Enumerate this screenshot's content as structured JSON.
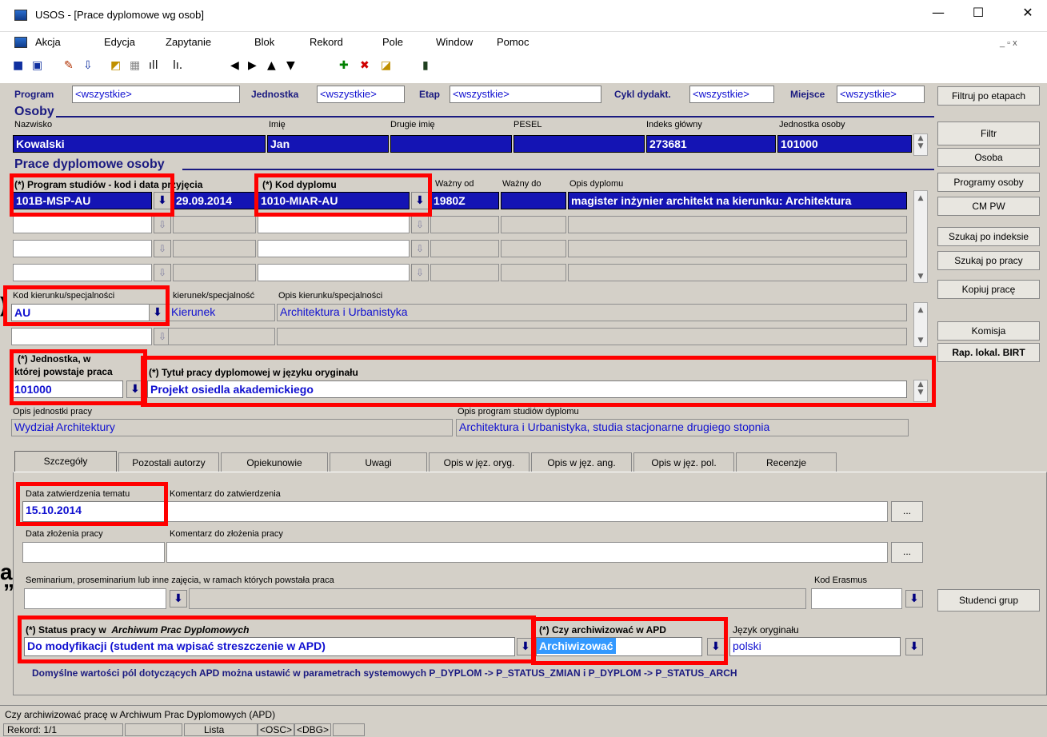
{
  "window": {
    "title": "USOS - [Prace dyplomowe wg osob]",
    "min": "—",
    "max": "☐",
    "close": "✕"
  },
  "menu": {
    "items": [
      "Akcja",
      "Edycja",
      "Zapytanie",
      "Blok",
      "Rekord",
      "Pole",
      "Window",
      "Pomoc"
    ],
    "mdi_controls": "_ ▫ x"
  },
  "toolbar": {
    "icons": [
      "save-icon",
      "print-icon",
      "edit-icon",
      "down-icon",
      "query-icon",
      "grid-icon",
      "chart-icon",
      "chart2-icon",
      "prev-icon",
      "next-icon",
      "up-icon",
      "down-arrow-icon",
      "insert-icon",
      "delete-icon",
      "clear-icon",
      "exit-icon"
    ]
  },
  "filter": {
    "program_label": "Program",
    "program_value": "<wszystkie>",
    "jednostka_label": "Jednostka",
    "jednostka_value": "<wszystkie>",
    "etap_label": "Etap",
    "etap_value": "<wszystkie>",
    "cykl_label": "Cykl dydakt.",
    "cykl_value": "<wszystkie>",
    "miejsce_label": "Miejsce",
    "miejsce_value": "<wszystkie>"
  },
  "osoby": {
    "title": "Osoby",
    "nazwisko_label": "Nazwisko",
    "nazwisko": "Kowalski",
    "imie_label": "Imię",
    "imie": "Jan",
    "drugie_label": "Drugie imię",
    "pesel_label": "PESEL",
    "indeks_label": "Indeks główny",
    "indeks": "273681",
    "jednostka_label": "Jednostka osoby",
    "jednostka": "101000"
  },
  "prace": {
    "title": "Prace dyplomowe osoby",
    "program_label": "(*) Program studiów - kod i data przyjęcia",
    "program": "101B-MSP-AU",
    "data": "29.09.2014",
    "kod_label": "(*) Kod dyplomu",
    "kod": "1010-MIAR-AU",
    "wazny_od_label": "Ważny od",
    "wazny_od": "1980Z",
    "wazny_do_label": "Ważny do",
    "opis_label": "Opis dyplomu",
    "opis": "magister inżynier architekt na kierunku: Architektura"
  },
  "kierunek": {
    "kod_label": "Kod kierunku/specjalności",
    "kod": "AU",
    "typ_label": "kierunek/specjalność",
    "typ": "Kierunek",
    "opis_label": "Opis kierunku/specjalności",
    "opis": "Architektura i Urbanistyka"
  },
  "praca": {
    "jedn_label1": "(*) Jednostka, w",
    "jedn_label2": "której powstaje praca",
    "jedn": "101000",
    "tytul_label": "(*) Tytuł pracy dyplomowej w języku oryginału",
    "tytul": "Projekt osiedla akademickiego",
    "opis_jedn_label": "Opis jednostki pracy",
    "opis_jedn": "Wydział Architektury",
    "opis_prog_label": "Opis program studiów dyplomu",
    "opis_prog": "Architektura i Urbanistyka, studia stacjonarne drugiego stopnia"
  },
  "tabs": [
    "Szczegóły",
    "Pozostali autorzy",
    "Opiekunowie",
    "Uwagi",
    "Opis w jęz. oryg.",
    "Opis w jęz. ang.",
    "Opis w jęz. pol.",
    "Recenzje"
  ],
  "details": {
    "data_zatw_label": "Data zatwierdzenia tematu",
    "data_zatw": "15.10.2014",
    "kom_zatw_label": "Komentarz do zatwierdzenia",
    "data_zloz_label": "Data złożenia pracy",
    "kom_zloz_label": "Komentarz do złożenia pracy",
    "dots": "...",
    "seminarium_label": "Seminarium, proseminarium lub inne zajęcia, w ramach których powstała praca",
    "erasmus_label": "Kod Erasmus",
    "status_label": "(*) Status pracy w",
    "status_label_it": "Archiwum Prac Dyplomowych",
    "status": "Do modyfikacji (student ma wpisać streszczenie w APD)",
    "arch_label": "(*) Czy archiwizować w APD",
    "arch": "Archiwizować",
    "jezyk_label": "Język oryginału",
    "jezyk": "polski",
    "note": "Domyślne wartości pól dotyczących APD można ustawić w parametrach systemowych P_DYPLOM -> P_STATUS_ZMIAN i P_DYPLOM -> P_STATUS_ARCH"
  },
  "buttons": {
    "filtruj": "Filtruj po etapach",
    "filtr": "Filtr",
    "osoba": "Osoba",
    "programy": "Programy osoby",
    "cmpw": "CM PW",
    "szukaj_indeks": "Szukaj po indeksie",
    "szukaj_praca": "Szukaj po pracy",
    "kopiuj": "Kopiuj pracę",
    "komisja": "Komisja",
    "rap": "Rap. lokal. BIRT",
    "studenci": "Studenci grup"
  },
  "status": {
    "hint": "Czy archiwizować pracę w Archiwum Prac Dyplomowych (APD)",
    "rekord": "Rekord: 1/1",
    "lista": "Lista wartości",
    "osc": "<OSC>",
    "dbg": "<DBG>"
  },
  "side_fragments": {
    "a": ")",
    "b": "a",
    "c": "”"
  }
}
